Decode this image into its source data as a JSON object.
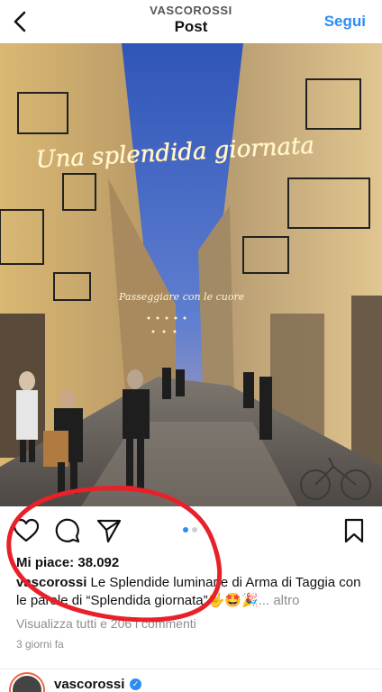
{
  "header": {
    "username": "VASCOROSSI",
    "title": "Post",
    "follow_label": "Segui"
  },
  "photo": {
    "sign_text": "Una splendida giornata",
    "sub_sign_text": "Passeggiare con le cuore"
  },
  "post": {
    "likes_label": "Mi piace: 38.092",
    "caption_user": "vascorossi",
    "caption_text": " Le Splendide luminarie di Arma di Taggia con le parole di “Splendida giornata”🤟🤩🎉",
    "caption_more": "... altro",
    "comments_link": "Visualizza tutti e 206 i commenti",
    "date": "3 giorni fa"
  },
  "next_post": {
    "username": "vascorossi"
  },
  "colors": {
    "accent": "#2a8df5",
    "annotation": "#e8202a"
  }
}
